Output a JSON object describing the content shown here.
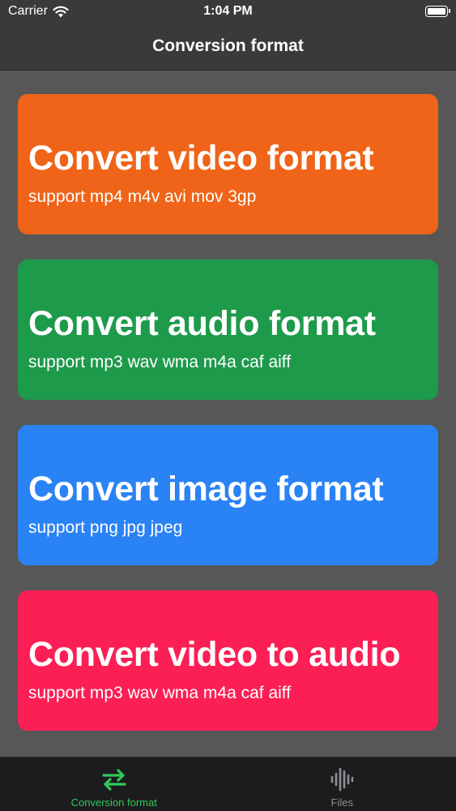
{
  "status_bar": {
    "carrier": "Carrier",
    "time": "1:04 PM"
  },
  "nav": {
    "title": "Conversion format"
  },
  "cards": [
    {
      "title": "Convert video format",
      "subtitle": "support mp4 m4v avi mov 3gp",
      "color": "#ef6418"
    },
    {
      "title": "Convert audio format",
      "subtitle": "support mp3 wav wma m4a caf aiff",
      "color": "#1e9a4b"
    },
    {
      "title": "Convert image format",
      "subtitle": "support png jpg jpeg",
      "color": "#2a83f5"
    },
    {
      "title": "Convert video to audio",
      "subtitle": "support mp3 wav wma m4a caf aiff",
      "color": "#fc1f55"
    }
  ],
  "tab_bar": {
    "tabs": [
      {
        "label": "Conversion format",
        "icon": "arrows-swap-icon",
        "active": true
      },
      {
        "label": "Files",
        "icon": "waveform-icon",
        "active": false
      }
    ],
    "active_color": "#30c85a",
    "inactive_color": "#8e8e93"
  },
  "colors": {
    "background": "#575757",
    "bars": "#3a3a3c",
    "tab_bar_bg": "#1c1c1e"
  }
}
